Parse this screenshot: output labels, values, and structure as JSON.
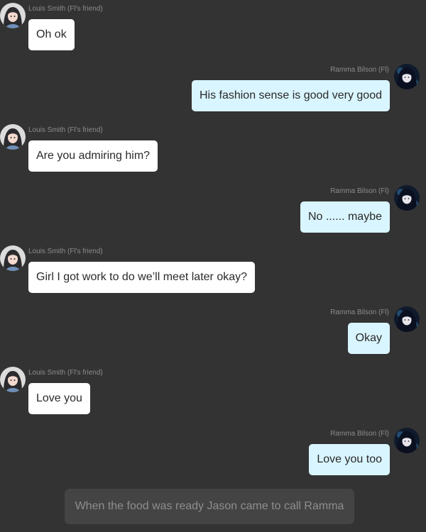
{
  "colors": {
    "background": "#333333",
    "friend_bubble": "#ffffff",
    "main_bubble": "#d9f5ff",
    "narration_bubble": "#444444",
    "sender_text": "#8c8c8c"
  },
  "messages": [
    {
      "side": "left",
      "sender": "Louis Smith (Fl's friend)",
      "text": "Oh ok",
      "avatar": "friend-avatar-icon"
    },
    {
      "side": "right",
      "sender": "Ramma Bilson (Fl)",
      "text": "His fashion sense is good very good",
      "avatar": "ramma-avatar-icon"
    },
    {
      "side": "left",
      "sender": "Louis Smith (Fl's friend)",
      "text": "Are you admiring him?",
      "avatar": "friend-avatar-icon"
    },
    {
      "side": "right",
      "sender": "Ramma Bilson (Fl)",
      "text": "No ...... maybe",
      "avatar": "ramma-avatar-icon"
    },
    {
      "side": "left",
      "sender": "Louis Smith (Fl's friend)",
      "text": "Girl I got work to do we’ll meet later okay?",
      "avatar": "friend-avatar-icon"
    },
    {
      "side": "right",
      "sender": "Ramma Bilson (Fl)",
      "text": "Okay",
      "avatar": "ramma-avatar-icon"
    },
    {
      "side": "left",
      "sender": "Louis Smith (Fl's friend)",
      "text": "Love you",
      "avatar": "friend-avatar-icon"
    },
    {
      "side": "right",
      "sender": "Ramma Bilson (Fl)",
      "text": "Love you too",
      "avatar": "ramma-avatar-icon"
    }
  ],
  "narration": "When the food was ready Jason came to call Ramma"
}
